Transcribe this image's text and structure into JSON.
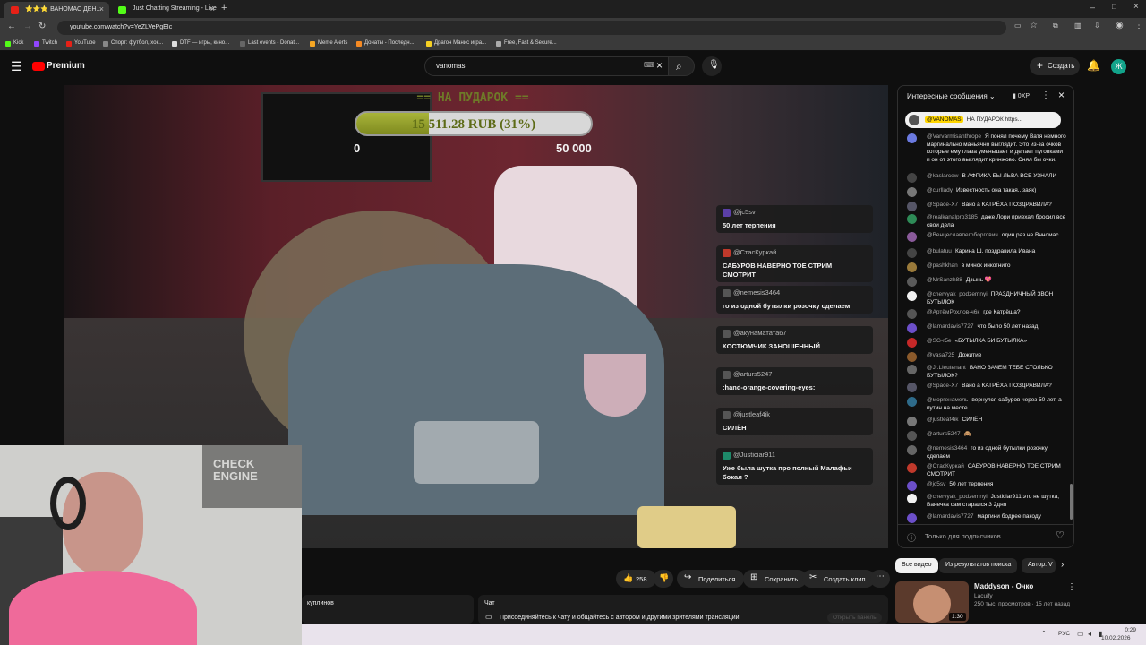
{
  "browser": {
    "tabs": [
      {
        "label": "⭐⭐⭐ ВАНОМАС ДЕН...",
        "active": true,
        "color": "#e62117"
      },
      {
        "label": "Just Chatting Streaming - Live",
        "active": false,
        "color": "#53fc18"
      }
    ],
    "url": "youtube.com/watch?v=YeZLVePgEIc",
    "bookmarks": [
      "Kick",
      "Twitch",
      "YouTube",
      "Спорт: футбол, хок...",
      "DTF — игры, кино...",
      "Last events - Donat...",
      "Meme Alerts",
      "Донаты - Последн...",
      "Драгон Манис игра...",
      "Free, Fast & Secure..."
    ]
  },
  "youtube": {
    "logo": "Premium",
    "search_value": "vanomas",
    "create_label": "Создать",
    "avatar_letter": "Ж"
  },
  "video": {
    "donation_title": "== НА ПУДАРОК ==",
    "donation_text": "15 511.28 RUB (31%)",
    "donation_progress": 0.31,
    "donation_min": "0",
    "donation_max": "50 000",
    "overlay_messages": [
      {
        "user": "@jc5sv",
        "text": "50 лет терпения"
      },
      {
        "user": "@СтасКуркай",
        "text": "САБУРОВ НАВЕРНО ТОЕ СТРИМ СМОТРИТ"
      },
      {
        "user": "@nemesis3464",
        "text": "го из одной бутылки розочку сделаем"
      },
      {
        "user": "@акунаматата67",
        "text": "КОСТЮМЧИК ЗАНОШЕННЫЙ"
      },
      {
        "user": "@arturs5247",
        "text": ":hand-orange-covering-eyes:"
      },
      {
        "user": "@justleaf4ik",
        "text": "СИЛЁН"
      },
      {
        "user": "@Justiciar911",
        "text": "Уже была шутка про полный Малафьи бокал ?"
      }
    ],
    "webcam_sign": "CHECK ENGINE"
  },
  "chat": {
    "header": "Интересные сообщения",
    "points": "0XP",
    "pinned_user": "@VANOMAS",
    "pinned_text": "НА ПУДАРОК https...",
    "messages": [
      {
        "user": "@Varvarmisanthrope",
        "text": "Я понял почему Ватя немного маргинально маньячно выглядит. Это из-за очков которые ему глаза уменьшает и делает пуговками и он от этого выглядит кринжово. Снял бы очки."
      },
      {
        "user": "@kaslarcew",
        "text": "В АФРИКА БЫ ЛЬВА ВСЕ УЗНАЛИ"
      },
      {
        "user": "@curllady",
        "text": "Известность она такая.. заяк)"
      },
      {
        "user": "@Space-X7",
        "text": "Вано а КАТРЁХА ПОЗДРАВИЛА?"
      },
      {
        "user": "@realkanalpro3185",
        "text": "даже Лори приехал бросил все свои дела"
      },
      {
        "user": "@Венцеславпегоборгович",
        "text": "один раз не Внномас"
      },
      {
        "user": "@bulatuu",
        "text": "Карина Ш. поздравила Ивана"
      },
      {
        "user": "@pashkhan",
        "text": "в минск инкогнито"
      },
      {
        "user": "@MrSanzh88",
        "text": "Дзынь 💖"
      },
      {
        "user": "@chervyak_podzemnyi",
        "text": "ПРАЗДНИЧНЫЙ ЗВОН БУТЫЛОК"
      },
      {
        "user": "@АртёмРохлов-ч6к",
        "text": "где Катрёша?"
      },
      {
        "user": "@lamardavis7727",
        "text": "что было 50 лет назад"
      },
      {
        "user": "@SG-r5e",
        "text": "«БУТЫЛКА БИ БУТЫЛКА»"
      },
      {
        "user": "@vasa725",
        "text": "Дожитие"
      },
      {
        "user": "@Jr.Lieutenant",
        "text": "ВАНО ЗАЧЕМ ТЕБЕ СТОЛЬКО БУТЫЛОК?"
      },
      {
        "user": "@Space-X7",
        "text": "Вано а КАТРЁХА ПОЗДРАВИЛА?"
      },
      {
        "user": "@моргенамель",
        "text": "вернулся сабуров через 50 лет, а путин на месте"
      },
      {
        "user": "@justleaf4ik",
        "text": "СИЛЁН"
      },
      {
        "user": "@arturs5247",
        "text": "🙈"
      },
      {
        "user": "@nemesis3464",
        "text": "го из одной бутылки розочку сделаем"
      },
      {
        "user": "@СтасКуркай",
        "text": "САБУРОВ НАВЕРНО ТОЕ СТРИМ СМОТРИТ"
      },
      {
        "user": "@jc5sv",
        "text": "50 лет терпения"
      },
      {
        "user": "@chervyak_podzemnyi",
        "text": "Justiciar911 это не шутка, Ванечка сам старался 3 2дня"
      },
      {
        "user": "@lamardavis7727",
        "text": "мартини бодрее пакоду"
      }
    ],
    "footer": "Только для подписчиков"
  },
  "actions": {
    "like_count": "258",
    "share": "Поделиться",
    "save": "Сохранить",
    "clip": "Создать клип"
  },
  "below": {
    "left_text": "куплинов",
    "chat_label": "Чат",
    "chat_join_text": "Присоединяйтесь к чату и общайтесь с автором и другими зрителями трансляции.",
    "chat_button": "Открыть панель"
  },
  "related": {
    "chips": [
      "Все видео",
      "Из результатов поиска",
      "Автор: V"
    ],
    "video_title": "Maddyson - Очко",
    "video_channel": "Lacuify",
    "video_meta": "250 тыс. просмотров · 15 лет назад",
    "video_duration": "1:30"
  },
  "taskbar": {
    "lang": "РУС",
    "time": "0:29",
    "date": "10.02.2026"
  }
}
